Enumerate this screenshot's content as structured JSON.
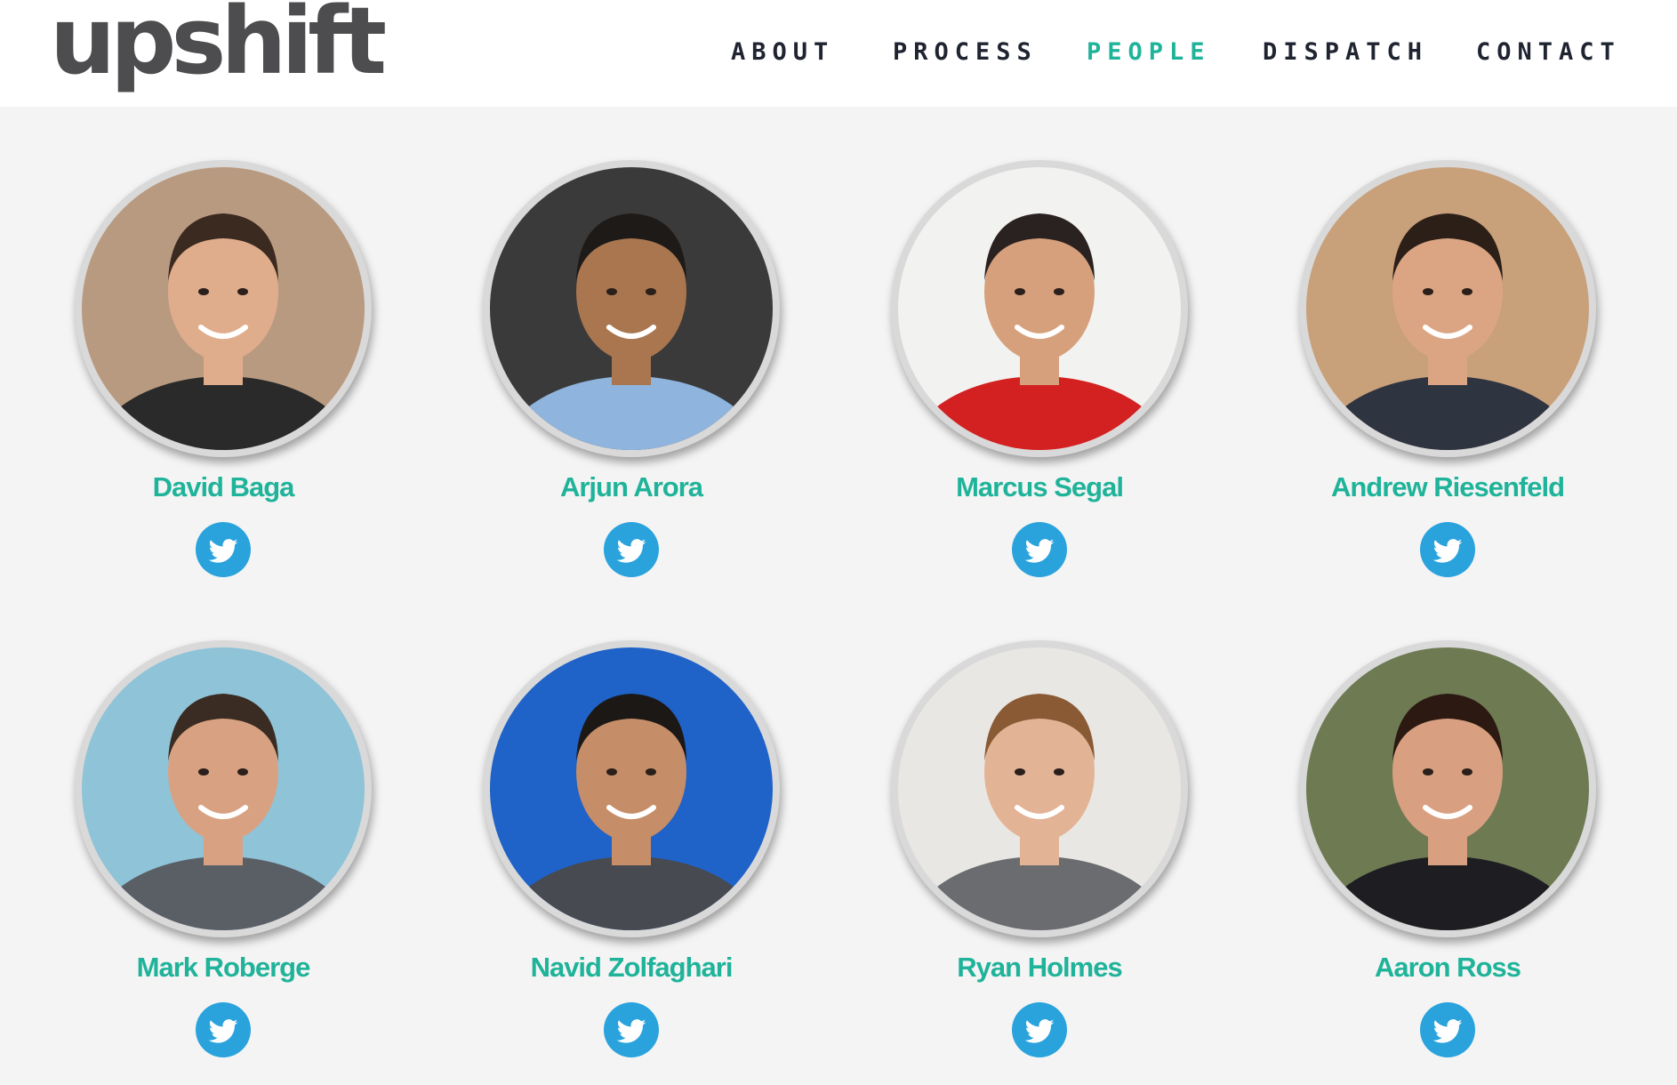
{
  "brand": {
    "logo_text": "upshift"
  },
  "nav": {
    "items": [
      {
        "label": "ABOUT",
        "active": false
      },
      {
        "label": "PROCESS",
        "active": false
      },
      {
        "label": "PEOPLE",
        "active": true
      },
      {
        "label": "DISPATCH",
        "active": false
      },
      {
        "label": "CONTACT",
        "active": false
      }
    ]
  },
  "colors": {
    "accent": "#1fb39a",
    "twitter": "#2aa3dd",
    "page_background": "#f4f4f4",
    "logo": "#4d4d4f"
  },
  "people": [
    {
      "name": "David Baga",
      "social": "twitter-icon",
      "photo": {
        "bg": "#b89a80",
        "skin": "#e0ad8c",
        "hair": "#3b2a20",
        "shirt": "#2a2a2a"
      }
    },
    {
      "name": "Arjun Arora",
      "social": "twitter-icon",
      "photo": {
        "bg": "#3a3a3a",
        "skin": "#a9764f",
        "hair": "#1e1a18",
        "shirt": "#8fb4de"
      }
    },
    {
      "name": "Marcus Segal",
      "social": "twitter-icon",
      "photo": {
        "bg": "#f2f2f0",
        "skin": "#d6a07c",
        "hair": "#2a2220",
        "shirt": "#d32020"
      }
    },
    {
      "name": "Andrew Riesenfeld",
      "social": "twitter-icon",
      "photo": {
        "bg": "#c8a07a",
        "skin": "#dba583",
        "hair": "#2c1f18",
        "shirt": "#2e3440"
      }
    },
    {
      "name": "Mark Roberge",
      "social": "twitter-icon",
      "photo": {
        "bg": "#8fc3d8",
        "skin": "#d8a282",
        "hair": "#3a2c22",
        "shirt": "#5a5f66"
      }
    },
    {
      "name": "Navid Zolfaghari",
      "social": "twitter-icon",
      "photo": {
        "bg": "#1f62c8",
        "skin": "#c58d68",
        "hair": "#1c1816",
        "shirt": "#474a50"
      }
    },
    {
      "name": "Ryan Holmes",
      "social": "twitter-icon",
      "photo": {
        "bg": "#e9e7e3",
        "skin": "#e3b396",
        "hair": "#8a5a35",
        "shirt": "#6a6c70"
      }
    },
    {
      "name": "Aaron Ross",
      "social": "twitter-icon",
      "photo": {
        "bg": "#6d7a52",
        "skin": "#d8a080",
        "hair": "#2c1a12",
        "shirt": "#1e1e22"
      }
    }
  ]
}
